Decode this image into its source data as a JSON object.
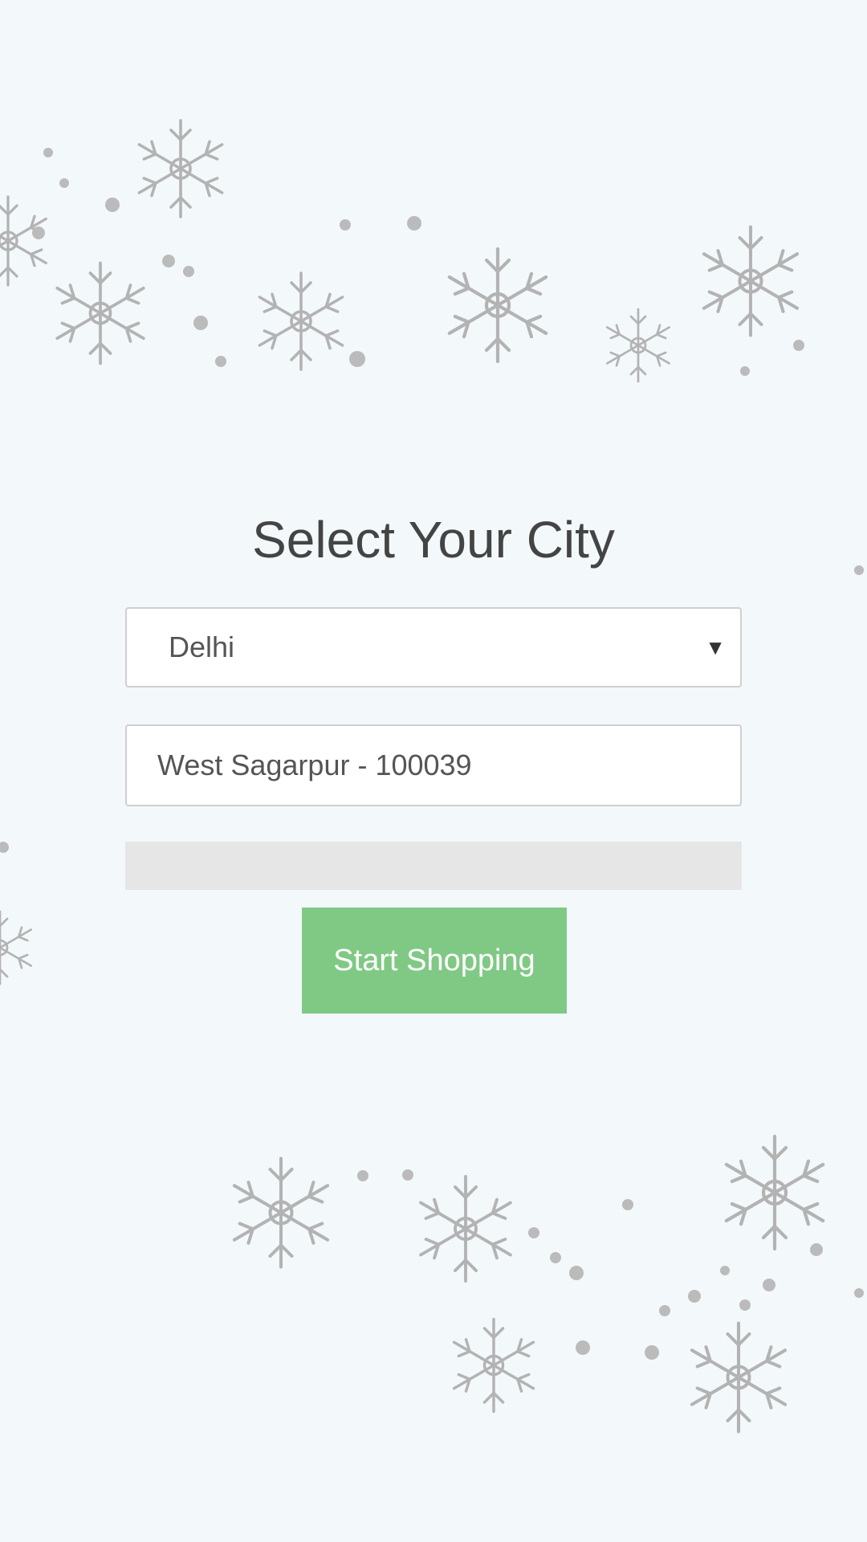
{
  "page": {
    "title": "Select Your City"
  },
  "city_select": {
    "selected": "Delhi",
    "arrow": "▼"
  },
  "area_input": {
    "value": "West Sagarpur - 100039"
  },
  "start_button": {
    "label": "Start Shopping"
  },
  "colors": {
    "background": "#f3f8fb",
    "button": "#80c985",
    "bar": "#e6e6e6",
    "snowflake": "#b5b5b5"
  },
  "decoration": {
    "icon": "snowflake-icon"
  }
}
